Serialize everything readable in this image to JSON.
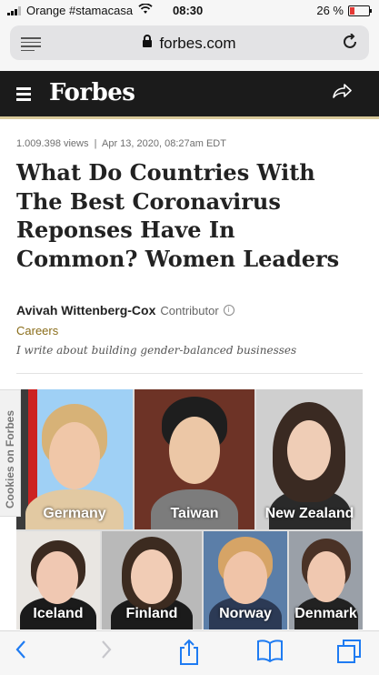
{
  "status": {
    "carrier": "Orange #stamacasa",
    "time": "08:30",
    "battery": "26 %"
  },
  "browser": {
    "domain": "forbes.com"
  },
  "header": {
    "logo": "Forbes"
  },
  "article": {
    "views": "1.009.398 views",
    "separator": "|",
    "date": "Apr 13, 2020, 08:27am EDT",
    "title": "What Do Countries With The Best Coronavirus Reponses Have In Common? Women Leaders",
    "author": "Avivah Wittenberg-Cox",
    "author_role": "Contributor",
    "info_glyph": "i",
    "category": "Careers",
    "bio": "I write about building gender-balanced businesses"
  },
  "gallery": {
    "labels": [
      "Germany",
      "Taiwan",
      "New Zealand",
      "Iceland",
      "Finland",
      "Norway",
      "Denmark"
    ]
  },
  "side_tab": {
    "label": "Cookies on Forbes"
  },
  "icons": [
    "wifi-icon",
    "lock-icon",
    "reader-icon",
    "reload-icon",
    "menu-icon",
    "share-icon",
    "back-icon",
    "forward-icon",
    "share-sheet-icon",
    "bookmarks-icon",
    "tabs-icon"
  ],
  "colors": {
    "accent": "#1e7bf2",
    "forbes_bar": "#1b1b1b",
    "gold_rule": "#d8c99a",
    "category": "#8a6d1a"
  }
}
